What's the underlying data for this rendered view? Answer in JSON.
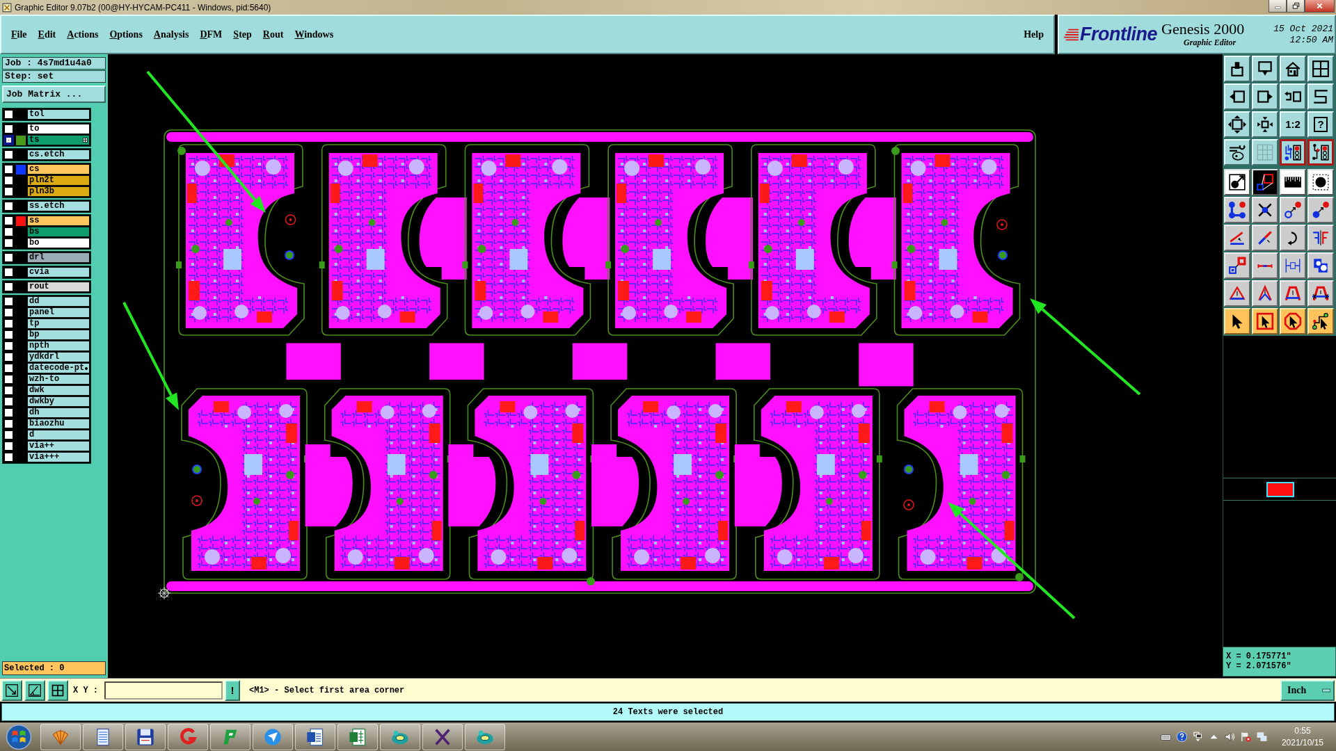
{
  "window": {
    "title": "Graphic Editor 9.07b2 (00@HY-HYCAM-PC411 - Windows, pid:5640)"
  },
  "menu": {
    "items": [
      "File",
      "Edit",
      "Actions",
      "Options",
      "Analysis",
      "DFM",
      "Step",
      "Rout",
      "Windows"
    ],
    "help": "Help"
  },
  "logo": {
    "brand": "Frontline",
    "product": "Genesis 2000",
    "module": "Graphic Editor",
    "date": "15 Oct 2021",
    "time": "12:50 AM"
  },
  "job_panel": {
    "job": "Job : 4s7md1u4a0",
    "step": "Step: set",
    "matrix_button": "Job Matrix ...",
    "selected": "Selected : 0"
  },
  "layers": [
    {
      "items": [
        {
          "name": "tol",
          "kind": "misc",
          "affected": false,
          "marker": false,
          "overflow": false
        }
      ]
    },
    {
      "items": [
        {
          "name": "to",
          "kind": "silk_screen",
          "affected": false,
          "marker": false,
          "overflow": false
        },
        {
          "name": "ts",
          "kind": "solder_mask",
          "color": "#4a9a1a",
          "affected": true,
          "marker": true,
          "overflow": false
        }
      ]
    },
    {
      "items": [
        {
          "name": "cs.etch",
          "kind": "misc",
          "affected": false,
          "marker": false,
          "overflow": false
        }
      ]
    },
    {
      "items": [
        {
          "name": "cs",
          "kind": "signal",
          "color": "#1038ff",
          "affected": false,
          "marker": false,
          "overflow": false
        },
        {
          "name": "pln2t",
          "kind": "power_ground",
          "affected": false,
          "marker": false,
          "overflow": false
        },
        {
          "name": "pln3b",
          "kind": "power_ground",
          "affected": false,
          "marker": false,
          "overflow": false
        }
      ]
    },
    {
      "items": [
        {
          "name": "ss.etch",
          "kind": "misc",
          "affected": false,
          "marker": false,
          "overflow": false
        }
      ]
    },
    {
      "items": [
        {
          "name": "ss",
          "kind": "signal",
          "color": "#ff1010",
          "affected": false,
          "marker": false,
          "overflow": false
        },
        {
          "name": "bs",
          "kind": "solder_mask",
          "affected": false,
          "marker": false,
          "overflow": false
        },
        {
          "name": "bo",
          "kind": "silk_screen",
          "affected": false,
          "marker": false,
          "overflow": false
        }
      ]
    },
    {
      "items": [
        {
          "name": "drl",
          "kind": "drill",
          "affected": false,
          "marker": false,
          "overflow": false
        }
      ]
    },
    {
      "items": [
        {
          "name": "cvia",
          "kind": "misc",
          "affected": false,
          "marker": false,
          "overflow": false
        }
      ]
    },
    {
      "items": [
        {
          "name": "rout",
          "kind": "rout",
          "affected": false,
          "marker": false,
          "overflow": false
        }
      ]
    },
    {
      "items": [
        {
          "name": "dd",
          "kind": "misc",
          "affected": false,
          "marker": false,
          "overflow": false
        },
        {
          "name": "panel",
          "kind": "misc",
          "affected": false,
          "marker": false,
          "overflow": false
        },
        {
          "name": "tp",
          "kind": "misc",
          "affected": false,
          "marker": false,
          "overflow": false
        },
        {
          "name": "bp",
          "kind": "misc",
          "affected": false,
          "marker": false,
          "overflow": false
        },
        {
          "name": "npth",
          "kind": "misc",
          "affected": false,
          "marker": false,
          "overflow": false
        },
        {
          "name": "ydkdrl",
          "kind": "misc",
          "affected": false,
          "marker": false,
          "overflow": false
        },
        {
          "name": "datecode-pt",
          "kind": "misc",
          "affected": false,
          "marker": false,
          "overflow": true
        },
        {
          "name": "wzh-to",
          "kind": "misc",
          "affected": false,
          "marker": false,
          "overflow": false
        },
        {
          "name": "dwk",
          "kind": "misc",
          "affected": false,
          "marker": false,
          "overflow": false
        },
        {
          "name": "dwkby",
          "kind": "misc",
          "affected": false,
          "marker": false,
          "overflow": false
        },
        {
          "name": "dh",
          "kind": "misc",
          "affected": false,
          "marker": false,
          "overflow": false
        },
        {
          "name": "biaozhu",
          "kind": "misc",
          "affected": false,
          "marker": false,
          "overflow": false
        },
        {
          "name": "d",
          "kind": "misc",
          "affected": false,
          "marker": false,
          "overflow": false
        },
        {
          "name": "via++",
          "kind": "misc",
          "affected": false,
          "marker": false,
          "overflow": false
        },
        {
          "name": "via+++",
          "kind": "misc",
          "affected": false,
          "marker": false,
          "overflow": false
        }
      ]
    }
  ],
  "toolbar": [
    {
      "on": false
    },
    {
      "on": false
    },
    {
      "on": false
    },
    {
      "on": false
    },
    {
      "on": false
    },
    {
      "on": false
    },
    {
      "on": false
    },
    {
      "on": false
    },
    {
      "on": false
    },
    {
      "on": false
    },
    {
      "on": false,
      "label": "1:2"
    },
    {
      "on": false,
      "label": "?"
    },
    {
      "on": false
    },
    {
      "on": false
    },
    {
      "on": true
    },
    {
      "on": true
    },
    {
      "on": false
    },
    {
      "on": false
    },
    {
      "on": false
    },
    {
      "on": false
    },
    {
      "on": false
    },
    {
      "on": false
    },
    {
      "on": false
    },
    {
      "on": false
    },
    {
      "on": false
    },
    {
      "on": false
    },
    {
      "on": false
    },
    {
      "on": false
    },
    {
      "on": false
    },
    {
      "on": false
    },
    {
      "on": false
    },
    {
      "on": false
    },
    {
      "on": false
    },
    {
      "on": false
    },
    {
      "on": false
    },
    {
      "on": false
    },
    {
      "on": false
    },
    {
      "on": false
    },
    {
      "on": false
    },
    {
      "on": false
    }
  ],
  "coordinates": {
    "x": "X = 0.175771\"",
    "y": "Y = 2.071576\""
  },
  "command_line": {
    "label": "X Y :",
    "execute": "!",
    "prompt": "<M1> - Select first area corner",
    "units": "Inch"
  },
  "status_bar": {
    "message": "24 Texts were selected"
  },
  "taskbar": {
    "time": "0:55",
    "date": "2021/10/15"
  }
}
